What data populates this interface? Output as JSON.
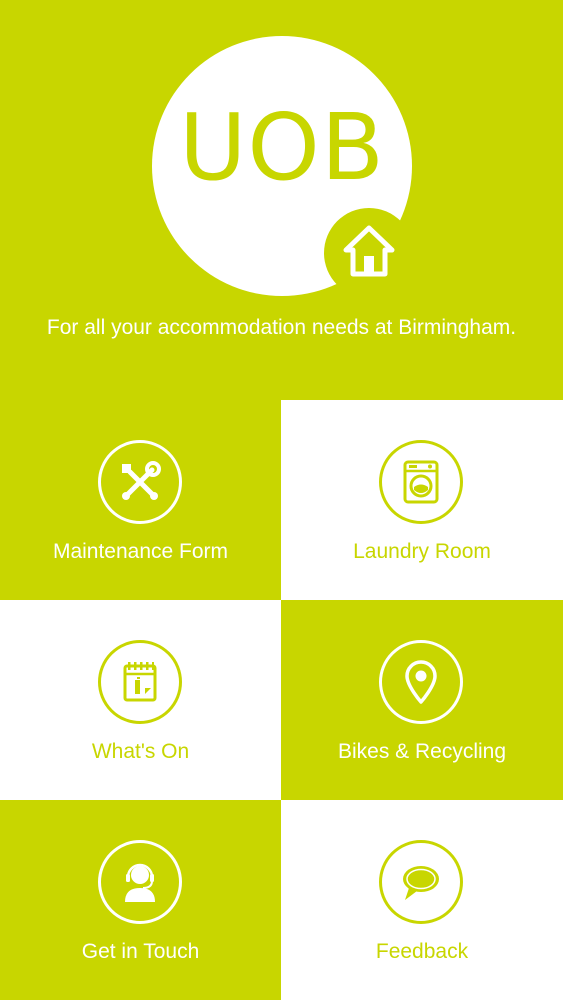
{
  "header": {
    "logo_text": "UOB",
    "tagline": "For all your accommodation needs at Birmingham."
  },
  "tiles": [
    {
      "label": "Maintenance Form",
      "icon": "tools-icon"
    },
    {
      "label": "Laundry Room",
      "icon": "washing-machine-icon"
    },
    {
      "label": "What's On",
      "icon": "calendar-icon"
    },
    {
      "label": "Bikes & Recycling",
      "icon": "location-pin-icon"
    },
    {
      "label": "Get in Touch",
      "icon": "headset-person-icon"
    },
    {
      "label": "Feedback",
      "icon": "speech-bubble-icon"
    }
  ],
  "colors": {
    "brand_green": "#c8d600",
    "white": "#ffffff"
  }
}
